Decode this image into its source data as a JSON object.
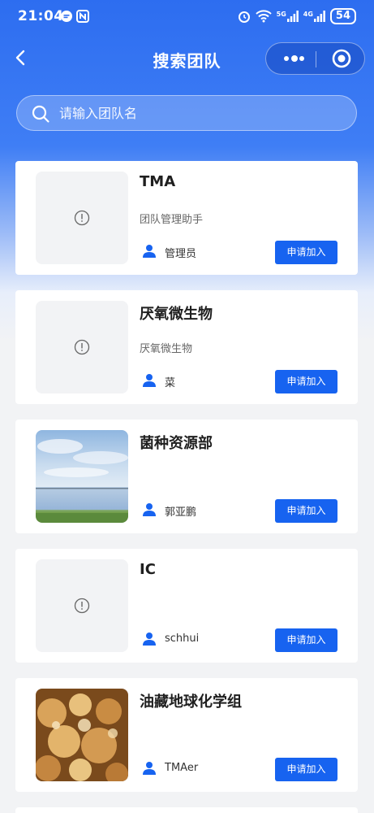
{
  "status_bar": {
    "time": "21:04",
    "battery": "54",
    "net_5g": "5G",
    "net_4g": "4G"
  },
  "nav": {
    "title": "搜索团队"
  },
  "search": {
    "placeholder": "请输入团队名"
  },
  "teams": [
    {
      "name": "TMA",
      "description": "团队管理助手",
      "member": "管理员",
      "join_label": "申请加入",
      "image": "placeholder"
    },
    {
      "name": "厌氧微生物",
      "description": "厌氧微生物",
      "member": "菜",
      "join_label": "申请加入",
      "image": "placeholder"
    },
    {
      "name": "菌种资源部",
      "description": "",
      "member": "郭亚鹏",
      "join_label": "申请加入",
      "image": "lake-photo"
    },
    {
      "name": "IC",
      "description": "",
      "member": "schhui",
      "join_label": "申请加入",
      "image": "placeholder"
    },
    {
      "name": "油藏地球化学组",
      "description": "",
      "member": "TMAer",
      "join_label": "申请加入",
      "image": "golden-bubbles-photo"
    }
  ],
  "colors": {
    "primary": "#1763f0",
    "header_blue": "#2d6df0",
    "page_bg": "#f2f3f5"
  }
}
